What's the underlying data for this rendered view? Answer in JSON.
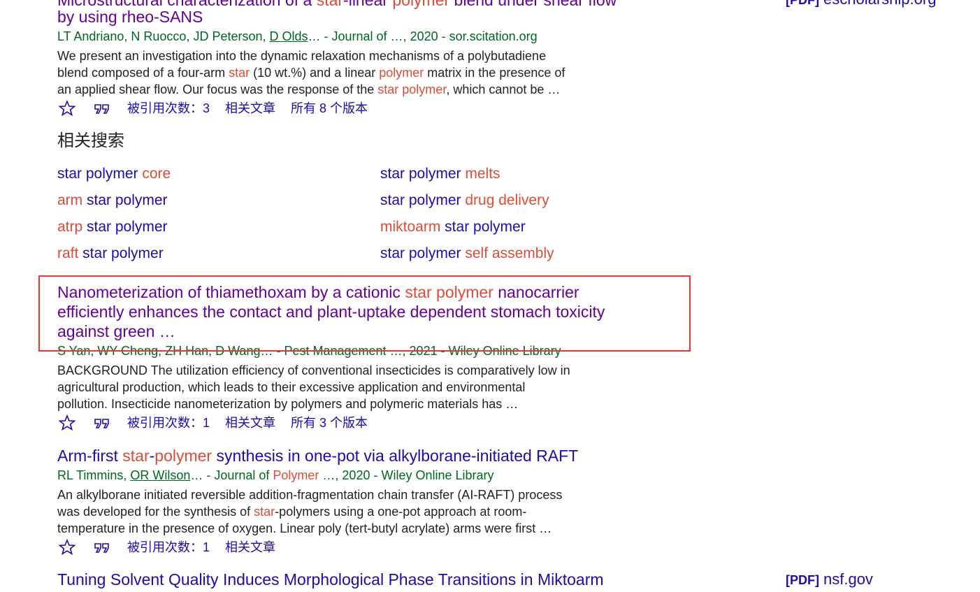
{
  "results": [
    {
      "title_parts": [
        {
          "t": "Microstructural characterization of a ",
          "hl": false
        },
        {
          "t": "star",
          "hl": true
        },
        {
          "t": "-linear ",
          "hl": false
        },
        {
          "t": "polymer",
          "hl": true
        },
        {
          "t": " blend under shear flow",
          "hl": false
        }
      ],
      "title_line2": "by using rheo-SANS",
      "source_tag": "[PDF]",
      "source_domain": "escholarship.org",
      "meta_authors_pre": "LT Andriano, N Ruocco, JD Peterson, ",
      "meta_author_link": "D Olds",
      "meta_rest": "… - Journal of …, 2020 - sor.scitation.org",
      "snippet_lines": [
        [
          {
            "t": "We present an investigation into the dynamic relaxation mechanisms of a polybutadiene",
            "hl": false
          }
        ],
        [
          {
            "t": "blend composed of a four-arm ",
            "hl": false
          },
          {
            "t": "star",
            "hl": true
          },
          {
            "t": " (10 wt.%) and a linear ",
            "hl": false
          },
          {
            "t": "polymer",
            "hl": true
          },
          {
            "t": " matrix in the presence of",
            "hl": false
          }
        ],
        [
          {
            "t": "an applied shear flow. Our focus was the response of the ",
            "hl": false
          },
          {
            "t": "star polymer",
            "hl": true
          },
          {
            "t": ", which cannot be …",
            "hl": false
          }
        ]
      ],
      "cited_by": "被引用次数：3",
      "related": "相关文章",
      "versions": "所有 8 个版本"
    },
    {
      "title_parts_l1": [
        {
          "t": "Nanometerization of thiamethoxam by a cationic ",
          "hl": false
        },
        {
          "t": "star polymer",
          "hl": true
        },
        {
          "t": " nanocarrier",
          "hl": false
        }
      ],
      "title_line2": "efficiently enhances the contact and plant-uptake dependent stomach toxicity",
      "title_line3": "against green …",
      "meta": "S Yan, WY Cheng, ZH Han, D Wang… - Pest Management …, 2021 - Wiley Online Library",
      "snippet_lines": [
        "BACKGROUND The utilization efficiency of conventional insecticides is comparatively low in",
        "agricultural production, which leads to their excessive application and environmental",
        "pollution. Insecticide nanometerization by polymers and polymeric materials has …"
      ],
      "cited_by": "被引用次数：1",
      "related": "相关文章",
      "versions": "所有 3 个版本"
    },
    {
      "title_parts": [
        {
          "t": "Arm-first ",
          "hl": false
        },
        {
          "t": "star",
          "hl": true
        },
        {
          "t": "-",
          "hl": false
        },
        {
          "t": "polymer",
          "hl": true
        },
        {
          "t": " synthesis in one-pot via alkylborane-initiated RAFT",
          "hl": false
        }
      ],
      "meta_authors_pre": "RL Timmins, ",
      "meta_author_link": "OR Wilson",
      "meta_rest_pre": "… - Journal of ",
      "meta_rest_hl": "Polymer",
      "meta_rest_post": " …, 2020 - Wiley Online Library",
      "snippet_lines": [
        [
          {
            "t": "An alkylborane initiated reversible addition-fragmentation chain transfer (AI-RAFT) process",
            "hl": false
          }
        ],
        [
          {
            "t": "was developed for the synthesis of ",
            "hl": false
          },
          {
            "t": "star",
            "hl": true
          },
          {
            "t": "-polymers using a one-pot approach at room-",
            "hl": false
          }
        ],
        [
          {
            "t": "temperature in the presence of oxygen. Linear poly (tert-butyl acrylate) arms were first …",
            "hl": false
          }
        ]
      ],
      "cited_by": "被引用次数：1",
      "related": "相关文章"
    },
    {
      "title": "Tuning Solvent Quality Induces Morphological Phase Transitions in Miktoarm",
      "source_tag": "[PDF]",
      "source_domain": "nsf.gov"
    }
  ],
  "related_searches": {
    "heading": "相关搜索",
    "left": [
      [
        {
          "t": "star polymer ",
          "hl": false
        },
        {
          "t": "core",
          "hl": true
        }
      ],
      [
        {
          "t": "arm",
          "hl": true
        },
        {
          "t": " star polymer",
          "hl": false
        }
      ],
      [
        {
          "t": "atrp",
          "hl": true
        },
        {
          "t": " star polymer",
          "hl": false
        }
      ],
      [
        {
          "t": "raft",
          "hl": true
        },
        {
          "t": " star polymer",
          "hl": false
        }
      ]
    ],
    "right": [
      [
        {
          "t": "star polymer ",
          "hl": false
        },
        {
          "t": "melts",
          "hl": true
        }
      ],
      [
        {
          "t": "star polymer ",
          "hl": false
        },
        {
          "t": "drug delivery",
          "hl": true
        }
      ],
      [
        {
          "t": "miktoarm",
          "hl": true
        },
        {
          "t": " star polymer",
          "hl": false
        }
      ],
      [
        {
          "t": "star polymer ",
          "hl": false
        },
        {
          "t": "self assembly",
          "hl": true
        }
      ]
    ]
  },
  "icons": {
    "save": "star-outline-icon",
    "cite": "quote-icon"
  },
  "colors": {
    "link": "#1a0dab",
    "visited": "#660099",
    "highlight": "#dd4b39",
    "meta": "#006621",
    "snippet": "#222222",
    "annotation_box": "#e53935"
  }
}
